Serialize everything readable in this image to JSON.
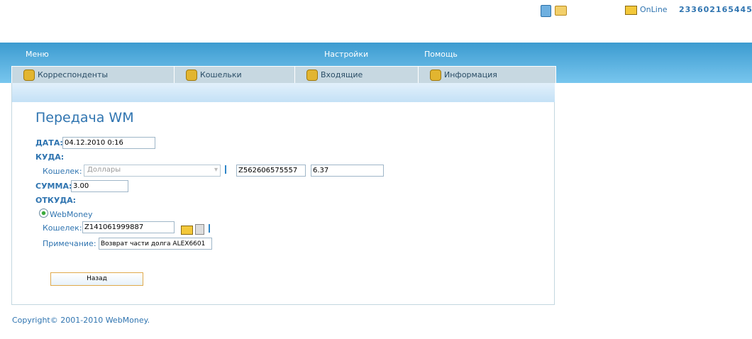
{
  "header": {
    "status": "OnLine",
    "wmid": "233602165445",
    "icons": [
      "phone-icon",
      "mail-icon",
      "id-card-icon"
    ]
  },
  "nav": {
    "menu": "Меню",
    "settings": "Настройки",
    "help": "Помощь"
  },
  "tabs": [
    {
      "label": "Корреспонденты",
      "icon": "contacts-icon"
    },
    {
      "label": "Кошельки",
      "icon": "wallet-icon"
    },
    {
      "label": "Входящие",
      "icon": "inbox-icon"
    },
    {
      "label": "Информация",
      "icon": "info-icon"
    }
  ],
  "form": {
    "title": "Передача WM",
    "date_label": "ДАТА:",
    "date_value": "04.12.2010 0:16",
    "to_label": "КУДА:",
    "to_wallet_label": "Кошелек:",
    "to_wallet_select": "Доллары",
    "to_purse": "Z562606575557",
    "to_balance": "6.37",
    "sum_label": "СУММА:",
    "sum_value": "3.00",
    "from_label": "ОТКУДА:",
    "from_option": "WebMoney",
    "from_wallet_label": "Кошелек:",
    "from_purse": "Z141061999887",
    "note_label": "Примечание:",
    "note_value": "Возврат части долга ALEX6601",
    "back_button": "Назад"
  },
  "footer": {
    "copyright": "Copyright© 2001-2010 WebMoney."
  }
}
